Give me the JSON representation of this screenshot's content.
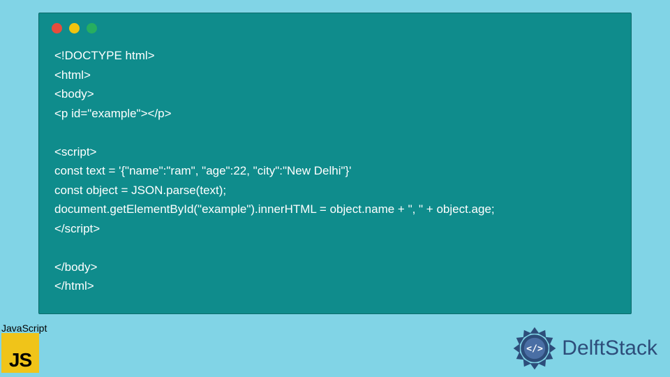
{
  "code": {
    "lines": [
      "<!DOCTYPE html>",
      "<html>",
      "<body>",
      "<p id=\"example\"></p>",
      "",
      "<script>",
      "const text = '{\"name\":\"ram\", \"age\":22, \"city\":\"New Delhi\"}'",
      "const object = JSON.parse(text);",
      "document.getElementById(\"example\").innerHTML = object.name + \", \" + object.age;",
      "</script>",
      "",
      "</body>",
      "</html>"
    ]
  },
  "badge": {
    "label": "JavaScript",
    "letters": "JS"
  },
  "brand": {
    "name": "DelftStack"
  },
  "colors": {
    "page_bg": "#81d4e6",
    "window_bg": "#0f8c8c",
    "js_yellow": "#f0c419",
    "brand_blue": "#2d4d7a",
    "red": "#e74c3c",
    "yellow": "#f1c40f",
    "green": "#27ae60"
  }
}
